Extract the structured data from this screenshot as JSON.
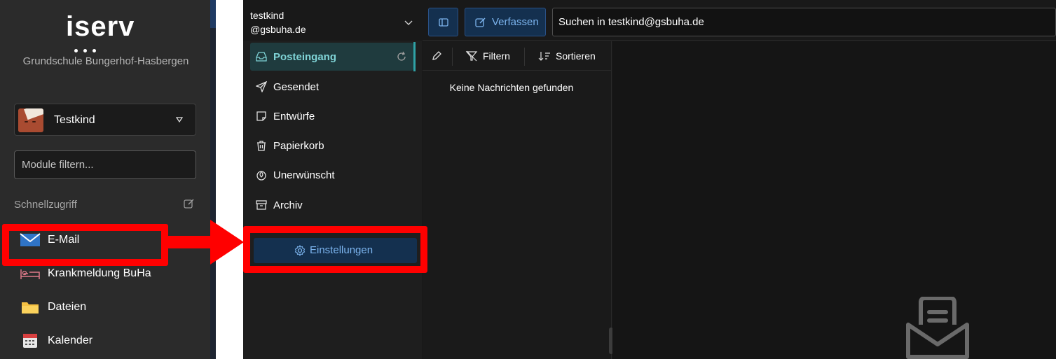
{
  "sidebar": {
    "logo_text": "iserv",
    "school_name": "Grundschule Bungerhof-Hasbergen",
    "user_name": "Testkind",
    "filter_placeholder": "Module filtern...",
    "quick_access_label": "Schnellzugriff",
    "items": [
      {
        "label": "E-Mail",
        "icon": "mail-icon"
      },
      {
        "label": "Krankmeldung BuHa",
        "icon": "bed-icon"
      },
      {
        "label": "Dateien",
        "icon": "folder-icon"
      },
      {
        "label": "Kalender",
        "icon": "calendar-icon"
      }
    ]
  },
  "mail": {
    "account_line1": "testkind",
    "account_line2": "@gsbuha.de",
    "folders": [
      {
        "label": "Posteingang",
        "icon": "inbox-icon",
        "active": true
      },
      {
        "label": "Gesendet",
        "icon": "send-icon"
      },
      {
        "label": "Entwürfe",
        "icon": "drafts-icon"
      },
      {
        "label": "Papierkorb",
        "icon": "trash-icon"
      },
      {
        "label": "Unerwünscht",
        "icon": "spam-icon"
      },
      {
        "label": "Archiv",
        "icon": "archive-icon"
      }
    ],
    "settings_label": "Einstellungen",
    "compose_label": "Verfassen",
    "search_placeholder": "Suchen in testkind@gsbuha.de",
    "filter_label": "Filtern",
    "sort_label": "Sortieren",
    "empty_message": "Keine Nachrichten gefunden"
  },
  "colors": {
    "highlight": "#ff0000",
    "accent_blue": "#7cb4ee",
    "accent_teal": "#7fd3d6"
  }
}
